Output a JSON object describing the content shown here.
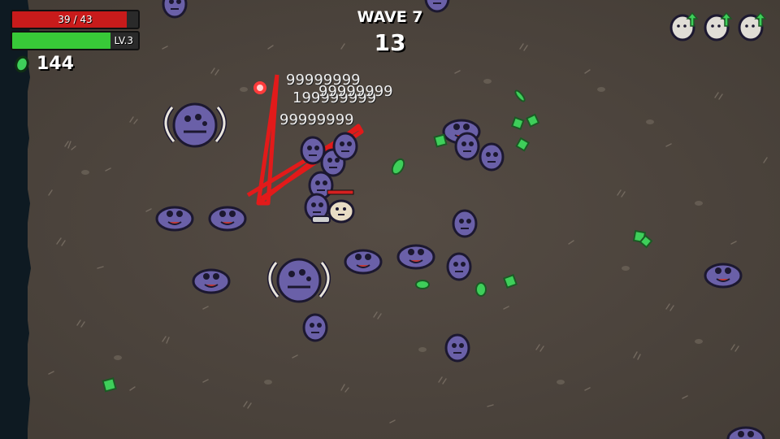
{
  "hud": {
    "hp_text": "39 / 43",
    "hp_fraction": 0.907,
    "xp_fraction": 0.78,
    "level_text": "LV.3",
    "materials_count": "144",
    "wave_label": "WAVE 7",
    "timer": "13"
  },
  "upgrades": [
    {
      "icon": "egg-level-up-icon"
    },
    {
      "icon": "egg-level-up-icon"
    },
    {
      "icon": "egg-level-up-icon"
    }
  ],
  "damage_numbers": [
    "99999999",
    "199999999",
    "99999999",
    "99999999"
  ],
  "colors": {
    "hp": "#c81b1b",
    "xp": "#38c938",
    "material": "#3ecf5a",
    "enemy": "#6a60a8",
    "laser": "#e21a1a"
  }
}
